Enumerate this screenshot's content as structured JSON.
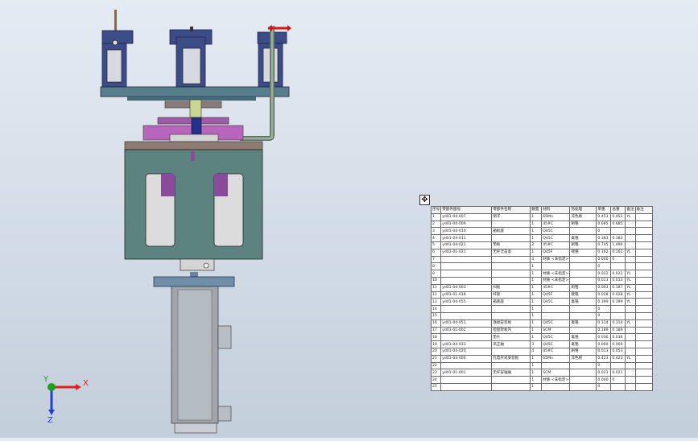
{
  "viewport": {
    "background_top": "#e4ebf3",
    "background_bottom": "#c3cedb"
  },
  "triad": {
    "x_label": "X",
    "y_label": "Y",
    "z_label": "Z",
    "x_color": "#e02020",
    "y_color": "#20a020",
    "z_color": "#2040d0"
  },
  "bom": {
    "move_icon": "move-handle-icon",
    "headers": [
      "序号",
      "零部件图号",
      "零部件名称",
      "数量",
      "材料",
      "热处理",
      "单重",
      "总重",
      "备注",
      "备注"
    ],
    "rows": [
      [
        "1",
        "yd01-04-007",
        "销子",
        "1",
        "65Mn",
        "淬色刷",
        "0.453",
        "0.453",
        "YL",
        ""
      ],
      [
        "2",
        "yd01-04-009",
        "",
        "1",
        "45#C",
        "刷铬",
        "0.685",
        "0.685",
        "",
        ""
      ],
      [
        "3",
        "yd01-04-010",
        "箱板座",
        "1",
        "Q45C",
        "",
        "0",
        "",
        "",
        ""
      ],
      [
        "4",
        "yd01-04-011",
        "",
        "1",
        "Q45C",
        "禽铬",
        "0.383",
        "0.383",
        "",
        ""
      ],
      [
        "5",
        "yd01-04-021",
        "垫板",
        "2",
        "45#C",
        "刷铬",
        "0.745",
        "1.490",
        "",
        ""
      ],
      [
        "6",
        "yd01-01-021",
        "无杆泛击高",
        "1",
        "Q45F",
        "镀铬",
        "0.162",
        "0.162",
        "YL",
        ""
      ],
      [
        "7",
        "",
        "",
        "4",
        "材质 <未指定>",
        "",
        "0.000",
        "0",
        "",
        ""
      ],
      [
        "8",
        "",
        "",
        "1",
        "",
        "",
        "0",
        "",
        "",
        ""
      ],
      [
        "9",
        "",
        "",
        "1",
        "材质 <未指定>",
        "",
        "0.022",
        "0.022",
        "YL",
        ""
      ],
      [
        "10",
        "",
        "",
        "1",
        "材质 <未指定>",
        "",
        "0.013",
        "0.013",
        "YL",
        ""
      ],
      [
        "11",
        "yd01-04-003",
        "扫板",
        "1",
        "45#C",
        "刷铬",
        "0.003",
        "0.187",
        "YL",
        ""
      ],
      [
        "12",
        "yd01-01-018",
        "杆套",
        "1",
        "Q45F",
        "镀铬",
        "0.028",
        "0.028",
        "YL",
        ""
      ],
      [
        "13",
        "yd01-04-055",
        "箱底座",
        "1",
        "Q45C",
        "禽铬",
        "0.399",
        "0.399",
        "YL",
        ""
      ],
      [
        "14",
        "",
        "",
        "1",
        "",
        "",
        "0",
        "",
        "",
        ""
      ],
      [
        "15",
        "",
        "",
        "1",
        "",
        "",
        "0",
        "",
        "",
        ""
      ],
      [
        "16",
        "yd01-04-051",
        "连接安装板",
        "1",
        "Q45C",
        "禽铬",
        "0.314",
        "0.314",
        "YL",
        ""
      ],
      [
        "17",
        "yd01-01-002",
        "检盘架板内",
        "1",
        "SCM",
        "",
        "0.189",
        "0.189",
        "",
        ""
      ],
      [
        "18",
        "",
        "垫片",
        "1",
        "Q45C",
        "禽铬",
        "0.036",
        "0.036",
        "",
        ""
      ],
      [
        "19",
        "yd01-04-033",
        "凤正轴",
        "3",
        "Q45C",
        "禽铬",
        "0.000",
        "0.000",
        "",
        ""
      ],
      [
        "20",
        "yd01-04-020",
        "",
        "4",
        "45#C",
        "刷铬",
        "0.013",
        "0.053",
        "",
        ""
      ],
      [
        "21",
        "yd01-04-006",
        "孔电开式安装板",
        "1",
        "65Mn",
        "淬色刷",
        "0.423",
        "0.423",
        "YL",
        ""
      ],
      [
        "22",
        "",
        "",
        "1",
        "",
        "",
        "0",
        "",
        "",
        ""
      ],
      [
        "23",
        "yd01-01-001",
        "无杆安轴厢",
        "1",
        "SCM",
        "",
        "0.021",
        "0.021",
        "",
        ""
      ],
      [
        "24",
        "",
        "",
        "1",
        "材质 <未指定>",
        "",
        "0.000",
        "0",
        "",
        ""
      ],
      [
        "25",
        "",
        "",
        "1",
        "",
        "",
        "0",
        "",
        "",
        ""
      ]
    ]
  }
}
